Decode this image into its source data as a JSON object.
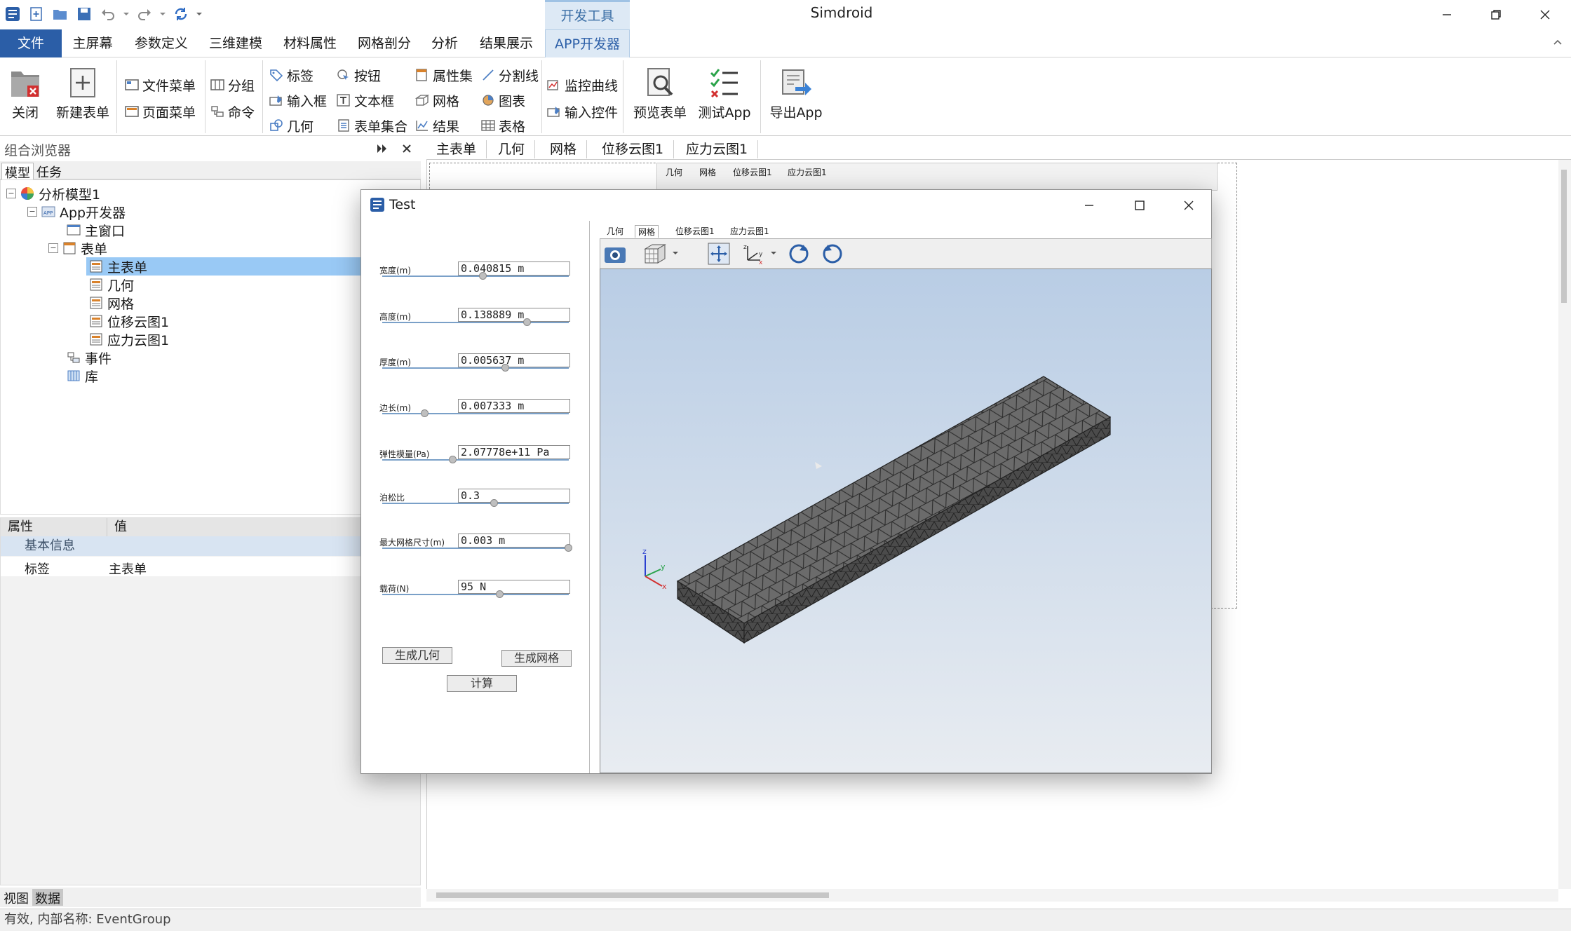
{
  "app": {
    "title": "Simdroid",
    "dev_tab_title": "开发工具"
  },
  "menubar": {
    "file": "文件",
    "items": [
      "主屏幕",
      "参数定义",
      "三维建模",
      "材料属性",
      "网格剖分",
      "分析",
      "结果展示",
      "APP开发器"
    ]
  },
  "ribbon": {
    "close": "关闭",
    "new_form": "新建表单",
    "file_menu": "文件菜单",
    "page_menu": "页面菜单",
    "group": "分组",
    "command": "命令",
    "label": "标签",
    "input_box": "输入框",
    "geometry": "几何",
    "button": "按钮",
    "text_box": "文本框",
    "form_set": "表单集合",
    "attr_set": "属性集",
    "mesh": "网格",
    "result": "结果",
    "divider": "分割线",
    "chart": "图表",
    "table": "表格",
    "monitor_curve": "监控曲线",
    "input_control": "输入控件",
    "preview_form": "预览表单",
    "test_app": "测试App",
    "export_app": "导出App"
  },
  "left_panel": {
    "title": "组合浏览器",
    "tabs": [
      "模型",
      "任务"
    ],
    "tree": {
      "root": "分析模型1",
      "app_dev": "App开发器",
      "main_window": "主窗口",
      "forms": "表单",
      "form_items": [
        "主表单",
        "几何",
        "网格",
        "位移云图1",
        "应力云图1"
      ],
      "events": "事件",
      "library": "库"
    },
    "props": {
      "col_attr": "属性",
      "col_value": "值",
      "section": "基本信息",
      "row_key": "标签",
      "row_value": "主表单"
    },
    "bottom_tabs": [
      "视图",
      "数据"
    ]
  },
  "editor": {
    "tabs": [
      "主表单",
      "几何",
      "网格",
      "位移云图1",
      "应力云图1"
    ]
  },
  "dialog": {
    "title": "Test",
    "params": [
      {
        "label": "宽度(m)",
        "value": "0.040815 m",
        "slider": 0.54
      },
      {
        "label": "高度(m)",
        "value": "0.138889 m",
        "slider": 0.78
      },
      {
        "label": "厚度(m)",
        "value": "0.005637 m",
        "slider": 0.66
      },
      {
        "label": "边长(m)",
        "value": "0.007333 m",
        "slider": 0.23
      },
      {
        "label": "弹性模量(Pa)",
        "value": "2.07778e+11 Pa",
        "slider": 0.38
      },
      {
        "label": "泊松比",
        "value": "0.3",
        "slider": 0.6
      },
      {
        "label": "最大网格尺寸(m)",
        "value": "0.003 m",
        "slider": 1.0
      },
      {
        "label": "载荷(N)",
        "value": "95 N",
        "slider": 0.63
      }
    ],
    "btn_geometry": "生成几何",
    "btn_mesh": "生成网格",
    "btn_compute": "计算",
    "view_tabs": [
      "几何",
      "网格",
      "位移云图1",
      "应力云图1"
    ],
    "axis": {
      "x": "x",
      "y": "y",
      "z": "z"
    }
  },
  "status": "有效, 内部名称: EventGroup",
  "colors": {
    "accent": "#2b5ea7",
    "tree_selected": "#99c9f5",
    "prop_section": "#d8e4f2"
  }
}
